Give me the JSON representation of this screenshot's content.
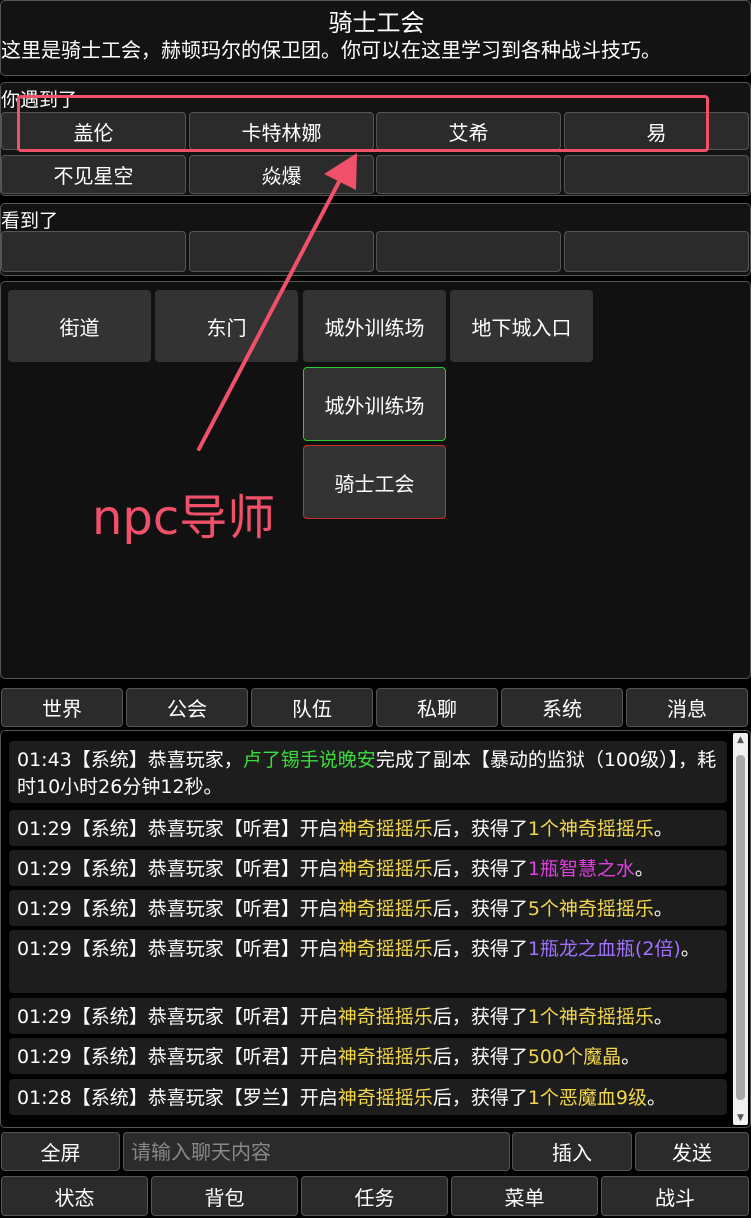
{
  "header": {
    "title": "骑士工会",
    "description": "这里是骑士工会，赫顿玛尔的保卫团。你可以在这里学习到各种战斗技巧。"
  },
  "npc_section": {
    "label": "你遇到了",
    "npcs": [
      "盖伦",
      "卡特林娜",
      "艾希",
      "易",
      "不见星空",
      "焱爆",
      "",
      ""
    ]
  },
  "see_section": {
    "label": "看到了",
    "items": [
      "",
      "",
      "",
      ""
    ]
  },
  "map": {
    "exits": [
      "街道",
      "东门",
      "城外训练场",
      "地下城入口"
    ],
    "current": "城外训练场",
    "target": "骑士工会"
  },
  "chat_tabs": [
    "世界",
    "公会",
    "队伍",
    "私聊",
    "系统",
    "消息"
  ],
  "messages": [
    {
      "time": "01:43",
      "tag": "【系统】",
      "pre": "恭喜玩家，",
      "player": "卢了锡手说晚安",
      "mid": "完成了副本【暴动的监狱（100级）】，耗时10小时26分钟12秒。"
    },
    {
      "time": "01:29",
      "tag": "【系统】",
      "pre": "恭喜玩家【听君】开启",
      "item": "神奇摇摇乐",
      "mid": "后，获得了",
      "reward": "1个神奇摇摇乐",
      "end": "。"
    },
    {
      "time": "01:29",
      "tag": "【系统】",
      "pre": "恭喜玩家【听君】开启",
      "item": "神奇摇摇乐",
      "mid": "后，获得了",
      "reward": "1瓶智慧之水",
      "end": "。"
    },
    {
      "time": "01:29",
      "tag": "【系统】",
      "pre": "恭喜玩家【听君】开启",
      "item": "神奇摇摇乐",
      "mid": "后，获得了",
      "reward": "5个神奇摇摇乐",
      "end": "。"
    },
    {
      "time": "01:29",
      "tag": "【系统】",
      "pre": "恭喜玩家【听君】开启",
      "item": "神奇摇摇乐",
      "mid": "后，获得了",
      "reward": "1瓶龙之血瓶(2倍)",
      "end": "。"
    },
    {
      "time": "01:29",
      "tag": "【系统】",
      "pre": "恭喜玩家【听君】开启",
      "item": "神奇摇摇乐",
      "mid": "后，获得了",
      "reward": "1个神奇摇摇乐",
      "end": "。"
    },
    {
      "time": "01:29",
      "tag": "【系统】",
      "pre": "恭喜玩家【听君】开启",
      "item": "神奇摇摇乐",
      "mid": "后，获得了",
      "reward": "500个魔晶",
      "end": "。"
    },
    {
      "time": "01:28",
      "tag": "【系统】",
      "pre": "恭喜玩家【罗兰】开启",
      "item": "神奇摇摇乐",
      "mid": "后，获得了",
      "reward": "1个恶魔血9级",
      "end": "。"
    }
  ],
  "chat_input": {
    "placeholder": "请输入聊天内容"
  },
  "chat_buttons": {
    "fullscreen": "全屏",
    "insert": "插入",
    "send": "发送"
  },
  "bottom_nav": [
    "状态",
    "背包",
    "任务",
    "菜单",
    "战斗"
  ],
  "annotation": {
    "label": "npc导师"
  },
  "colors": {
    "highlight_yellow": "#f2d64b",
    "player_green": "#3ddc3d",
    "magenta": "#e040e0",
    "purple": "#a070ff",
    "annotation_red": "#f0506a"
  }
}
